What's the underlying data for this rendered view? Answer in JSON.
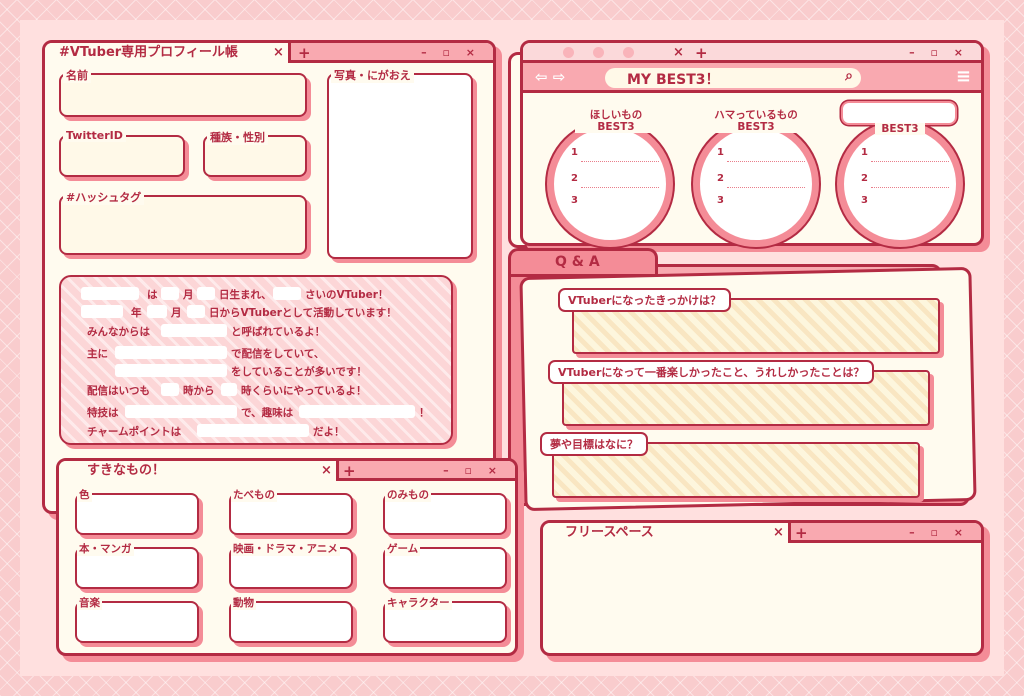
{
  "colors": {
    "accent": "#b32b43",
    "pink": "#f48c97",
    "cream": "#fffbef"
  },
  "profile": {
    "tab_title": "#VTuber専用プロフィール帳",
    "close": "×",
    "plus": "+",
    "controls": "– ▫ ×",
    "name_label": "名前",
    "twitter_label": "TwitterID",
    "species_label": "種族・性別",
    "hashtag_label": "#ハッシュタグ",
    "photo_label": "写真・にがおえ",
    "intro": {
      "l1a": "は",
      "l1b": "月",
      "l1c": "日生まれ、",
      "l1d": "さいのVTuber！",
      "l2a": "年",
      "l2b": "月",
      "l2c": "日からVTuberとして活動しています！",
      "l3a": "みんなからは",
      "l3b": "と呼ばれているよ！",
      "l4a": "主に",
      "l4b": "で配信をしていて、",
      "l5a": "をしていることが多いです！",
      "l6a": "配信はいつも",
      "l6b": "時から",
      "l6c": "時くらいにやっているよ！",
      "l7a": "特技は",
      "l7b": "で、趣味は",
      "l7c": "！",
      "l8a": "チャームポイントは",
      "l8b": "だよ！"
    }
  },
  "best": {
    "title": "MY BEST3！",
    "nav": "⇦ ⇨",
    "menu": "≡",
    "search_icon": "⌕",
    "items": [
      {
        "title1": "ほしいもの",
        "title2": "BEST3"
      },
      {
        "title1": "ハマっているもの",
        "title2": "BEST3"
      },
      {
        "title1": "",
        "title2": "BEST3"
      }
    ],
    "ranks": [
      "1",
      "2",
      "3"
    ]
  },
  "qa": {
    "tab_title": "Q & A",
    "q1": "VTuberになったきっかけは？",
    "q2": "VTuberになって一番楽しかったこと、うれしかったことは？",
    "q3": "夢や目標はなに？"
  },
  "favorites": {
    "tab_title": "すきなもの！",
    "items": [
      "色",
      "たべもの",
      "のみもの",
      "本・マンガ",
      "映画・ドラマ・アニメ",
      "ゲーム",
      "音楽",
      "動物",
      "キャラクター"
    ]
  },
  "free": {
    "tab_title": "フリースペース"
  }
}
